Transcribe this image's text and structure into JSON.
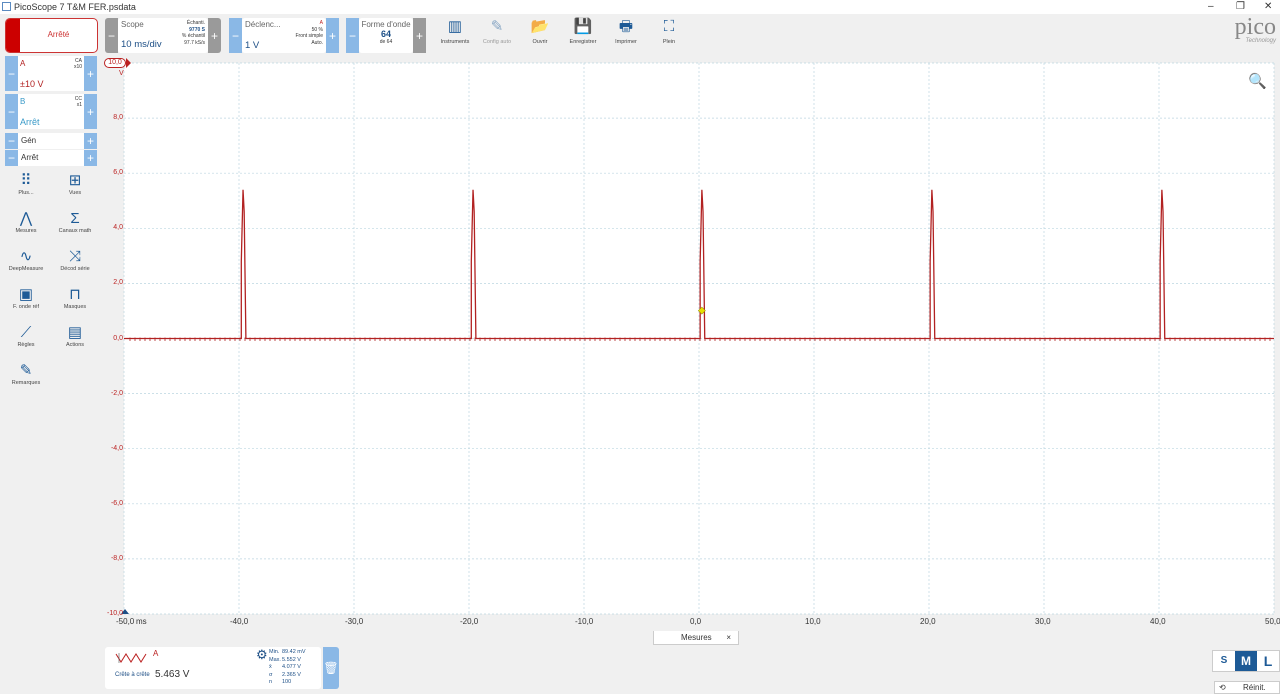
{
  "window": {
    "title": "PicoScope 7 T&M FER.psdata",
    "controls": [
      "–",
      "❐",
      "✕"
    ]
  },
  "run": {
    "label": "Arrêté"
  },
  "scope": {
    "label": "Scope",
    "timebase": "10 ms/div",
    "samples_label": "Échanti.",
    "samples": "9770 S",
    "rate_label": "% échantil",
    "rate": "97.7 kS/s"
  },
  "trigger": {
    "label": "Déclenc...",
    "channel": "A",
    "level": "1 V",
    "percent": "50 %",
    "type": "Front simple",
    "mode": "Auto."
  },
  "waveform": {
    "label": "Forme d'onde",
    "current": "64",
    "total": "de 64"
  },
  "toolbar": [
    {
      "label": "Instruments",
      "icon": "instruments-icon",
      "g": "▥"
    },
    {
      "label": "Config auto",
      "icon": "wand-icon",
      "g": "✎"
    },
    {
      "label": "Ouvrir",
      "icon": "folder-icon",
      "g": "📂"
    },
    {
      "label": "Enregistrer",
      "icon": "save-icon",
      "g": "💾"
    },
    {
      "label": "Imprimer",
      "icon": "print-icon",
      "g": "🖶"
    },
    {
      "label": "Plein",
      "icon": "fullscreen-icon",
      "g": "⛶"
    }
  ],
  "logo": {
    "name": "pico",
    "sub": "Technology"
  },
  "channels": [
    {
      "name": "A",
      "coupling": "CA",
      "probe": "x10",
      "range": "±10 V",
      "color": "#b22222"
    },
    {
      "name": "B",
      "coupling": "CC",
      "probe": "x1",
      "range": "Arrêt",
      "color": "#3a9ac8"
    }
  ],
  "generator": {
    "label": "Gén",
    "state": "Arrêt"
  },
  "sidebar": [
    {
      "label": "Plus...",
      "icon": "grid-icon",
      "g": "⠿"
    },
    {
      "label": "Vues",
      "icon": "views-icon",
      "g": "⊞"
    },
    {
      "label": "Mesures",
      "icon": "compass-icon",
      "g": "⋀"
    },
    {
      "label": "Canaux math",
      "icon": "sigma-icon",
      "g": "Σ"
    },
    {
      "label": "DeepMeasure",
      "icon": "deepmeasure-icon",
      "g": "∿"
    },
    {
      "label": "Décod série",
      "icon": "serial-decode-icon",
      "g": "⤨"
    },
    {
      "label": "F. onde réf",
      "icon": "reference-waveform-icon",
      "g": "▣"
    },
    {
      "label": "Masques",
      "icon": "masks-icon",
      "g": "⊓"
    },
    {
      "label": "Règles",
      "icon": "ruler-icon",
      "g": "⟋"
    },
    {
      "label": "Actions",
      "icon": "actions-icon",
      "g": "▤"
    },
    {
      "label": "Remarques",
      "icon": "notes-icon",
      "g": "✎"
    }
  ],
  "chart_data": {
    "type": "line",
    "xlabel": "ms",
    "ylabel": "V",
    "xlim": [
      -50,
      50
    ],
    "ylim": [
      -10,
      10
    ],
    "grid": true,
    "x_ticks": [
      "-50,0",
      "-40,0",
      "-30,0",
      "-20,0",
      "-10,0",
      "0,0",
      "10,0",
      "20,0",
      "30,0",
      "40,0",
      "50,0"
    ],
    "y_ticks": [
      "10,0",
      "8,0",
      "6,0",
      "4,0",
      "2,0",
      "0,0",
      "-2,0",
      "-4,0",
      "-6,0",
      "-8,0",
      "-10,0"
    ],
    "series": [
      {
        "name": "A",
        "color": "#b22222",
        "baseline": 0,
        "pulse_starts_ms": [
          -39.8,
          -19.8,
          0.1,
          20.1,
          40.1
        ],
        "pulse_peak_v": 5.4,
        "pulse_width_ms": 0.4
      }
    ],
    "trigger_marker": {
      "x": 0,
      "y": 1,
      "color": "#e8e000"
    }
  },
  "measure_tab": {
    "label": "Mesures",
    "close": "×"
  },
  "measurement": {
    "channel": "A",
    "name": "Crête à crête",
    "value": "5.463 V",
    "stats": [
      [
        "Min.",
        "89.42 mV"
      ],
      [
        "Max.",
        "5.552 V"
      ],
      [
        "x̄",
        "4.077 V"
      ],
      [
        "σ",
        "2.365 V"
      ],
      [
        "n",
        "100"
      ]
    ]
  },
  "size": {
    "options": [
      "S",
      "M",
      "L"
    ],
    "selected": "M"
  },
  "reset": {
    "label": "Réinit."
  }
}
